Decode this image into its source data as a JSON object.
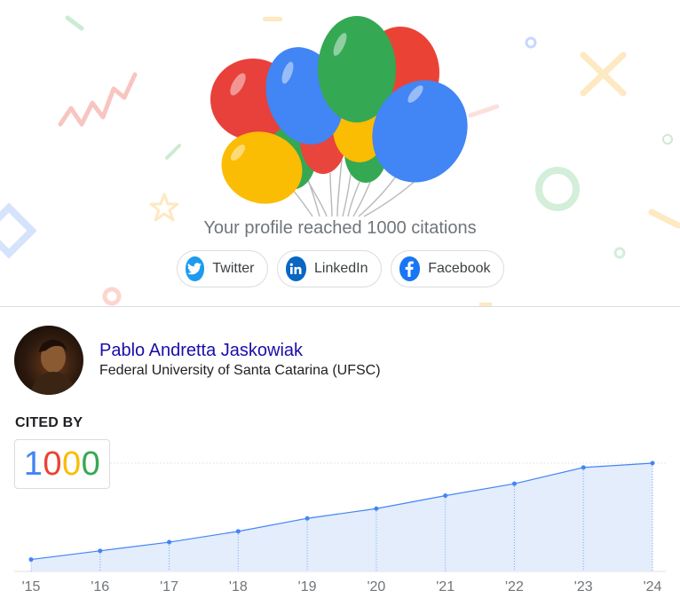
{
  "banner": {
    "message": "Your profile reached 1000 citations",
    "share": [
      {
        "label": "Twitter",
        "icon": "twitter-icon",
        "color": "#1d9bf0"
      },
      {
        "label": "LinkedIn",
        "icon": "linkedin-icon",
        "color": "#0a66c2"
      },
      {
        "label": "Facebook",
        "icon": "facebook-icon",
        "color": "#1877f2"
      }
    ]
  },
  "profile": {
    "name": "Pablo Andretta Jaskowiak",
    "affiliation": "Federal University of Santa Catarina (UFSC)"
  },
  "cited_by": {
    "label": "CITED BY",
    "count": "1000",
    "digit_colors": [
      "#4285f4",
      "#ea4335",
      "#fbbc04",
      "#34a853"
    ]
  },
  "colors": {
    "link": "#1a0dab",
    "chart_line": "#4285f4",
    "chart_fill": "#e3edfc"
  },
  "chart_data": {
    "type": "area",
    "x": [
      "'15",
      "'16",
      "'17",
      "'18",
      "'19",
      "'20",
      "'21",
      "'22",
      "'23",
      "'24"
    ],
    "values": [
      11,
      19,
      27,
      37,
      49,
      58,
      70,
      81,
      96,
      100
    ],
    "unit": "percent of final total",
    "ylim": [
      0,
      100
    ],
    "grid": false
  }
}
